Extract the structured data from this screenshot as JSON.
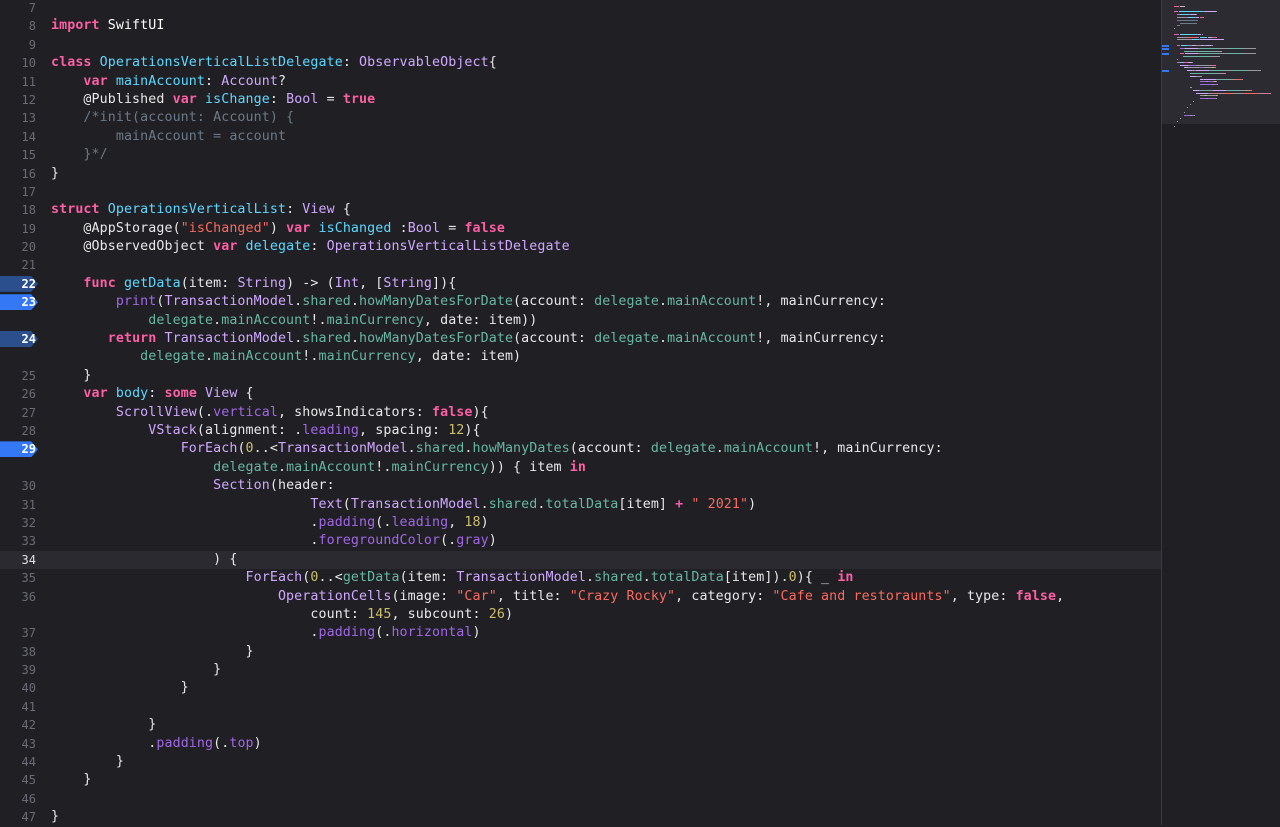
{
  "colors": {
    "background": "#1f1f24",
    "keyword": "#fc5fa3",
    "type": "#d0a8ff",
    "declaration": "#5dd8ff",
    "method": "#67b7a4",
    "property": "#a167e6",
    "string": "#fc6a5d",
    "number": "#d0bf69",
    "comment": "#6c7986",
    "breakpoint": "#3478f6"
  },
  "editor": {
    "current_line": 34,
    "lines": [
      {
        "num": "7",
        "tokens": []
      },
      {
        "num": "8",
        "tokens": [
          [
            "import",
            "kw"
          ],
          [
            " SwiftUI",
            "code"
          ]
        ]
      },
      {
        "num": "9",
        "tokens": []
      },
      {
        "num": "10",
        "tokens": [
          [
            "class",
            "kw"
          ],
          [
            " ",
            "plain"
          ],
          [
            "OperationsVerticalListDelegate",
            "decl"
          ],
          [
            ": ",
            "plain"
          ],
          [
            "ObservableObject",
            "type"
          ],
          [
            "{",
            "plain"
          ]
        ]
      },
      {
        "num": "11",
        "tokens": [
          [
            "    ",
            "plain"
          ],
          [
            "var",
            "kw"
          ],
          [
            " ",
            "plain"
          ],
          [
            "mainAccount",
            "decl"
          ],
          [
            ": ",
            "plain"
          ],
          [
            "Account",
            "type"
          ],
          [
            "?",
            "plain"
          ]
        ]
      },
      {
        "num": "12",
        "tokens": [
          [
            "    @Published ",
            "plain"
          ],
          [
            "var",
            "kw"
          ],
          [
            " ",
            "plain"
          ],
          [
            "isChange",
            "decl"
          ],
          [
            ": ",
            "plain"
          ],
          [
            "Bool",
            "type"
          ],
          [
            " = ",
            "plain"
          ],
          [
            "true",
            "kw"
          ]
        ]
      },
      {
        "num": "13",
        "tokens": [
          [
            "    /*init(account: Account) {",
            "cmt"
          ]
        ]
      },
      {
        "num": "14",
        "tokens": [
          [
            "        mainAccount = account",
            "cmt"
          ]
        ]
      },
      {
        "num": "15",
        "tokens": [
          [
            "    }*/",
            "cmt"
          ]
        ]
      },
      {
        "num": "16",
        "tokens": [
          [
            "}",
            "plain"
          ]
        ]
      },
      {
        "num": "17",
        "tokens": []
      },
      {
        "num": "18",
        "tokens": [
          [
            "struct",
            "kw"
          ],
          [
            " ",
            "plain"
          ],
          [
            "OperationsVerticalList",
            "decl"
          ],
          [
            ": ",
            "plain"
          ],
          [
            "View",
            "type"
          ],
          [
            " {",
            "plain"
          ]
        ]
      },
      {
        "num": "19",
        "tokens": [
          [
            "    @AppStorage(",
            "plain"
          ],
          [
            "\"isChanged\"",
            "str"
          ],
          [
            ") ",
            "plain"
          ],
          [
            "var",
            "kw"
          ],
          [
            " ",
            "plain"
          ],
          [
            "isChanged",
            "decl"
          ],
          [
            " :",
            "plain"
          ],
          [
            "Bool",
            "type"
          ],
          [
            " = ",
            "plain"
          ],
          [
            "false",
            "kw"
          ]
        ]
      },
      {
        "num": "20",
        "tokens": [
          [
            "    @ObservedObject ",
            "plain"
          ],
          [
            "var",
            "kw"
          ],
          [
            " ",
            "plain"
          ],
          [
            "delegate",
            "decl"
          ],
          [
            ": ",
            "plain"
          ],
          [
            "OperationsVerticalListDelegate",
            "type"
          ]
        ]
      },
      {
        "num": "21",
        "tokens": []
      },
      {
        "num": "22",
        "bp": "disabled",
        "tokens": [
          [
            "    ",
            "plain"
          ],
          [
            "func",
            "kw"
          ],
          [
            " ",
            "plain"
          ],
          [
            "getData",
            "decl"
          ],
          [
            "(item: ",
            "plain"
          ],
          [
            "String",
            "type"
          ],
          [
            ") -> (",
            "plain"
          ],
          [
            "Int",
            "type"
          ],
          [
            ", [",
            "plain"
          ],
          [
            "String",
            "type"
          ],
          [
            "]){",
            "plain"
          ]
        ]
      },
      {
        "num": "23",
        "bp": "enabled",
        "tokens": [
          [
            "        ",
            "plain"
          ],
          [
            "print",
            "ref"
          ],
          [
            "(",
            "plain"
          ],
          [
            "TransactionModel",
            "type"
          ],
          [
            ".",
            "plain"
          ],
          [
            "shared",
            "method"
          ],
          [
            ".",
            "plain"
          ],
          [
            "howManyDatesForDate",
            "method"
          ],
          [
            "(account: ",
            "plain"
          ],
          [
            "delegate",
            "method"
          ],
          [
            ".",
            "plain"
          ],
          [
            "mainAccount",
            "method"
          ],
          [
            "!, mainCurrency:",
            "plain"
          ]
        ]
      },
      {
        "num": "",
        "tokens": [
          [
            "            ",
            "plain"
          ],
          [
            "delegate",
            "method"
          ],
          [
            ".",
            "plain"
          ],
          [
            "mainAccount",
            "method"
          ],
          [
            "!.",
            "plain"
          ],
          [
            "mainCurrency",
            "method"
          ],
          [
            ", date: item))",
            "plain"
          ]
        ]
      },
      {
        "num": "24",
        "bp": "disabled",
        "tokens": [
          [
            "       ",
            "plain"
          ],
          [
            "return",
            "kw"
          ],
          [
            " ",
            "plain"
          ],
          [
            "TransactionModel",
            "type"
          ],
          [
            ".",
            "plain"
          ],
          [
            "shared",
            "method"
          ],
          [
            ".",
            "plain"
          ],
          [
            "howManyDatesForDate",
            "method"
          ],
          [
            "(account: ",
            "plain"
          ],
          [
            "delegate",
            "method"
          ],
          [
            ".",
            "plain"
          ],
          [
            "mainAccount",
            "method"
          ],
          [
            "!, mainCurrency:",
            "plain"
          ]
        ]
      },
      {
        "num": "",
        "tokens": [
          [
            "           ",
            "plain"
          ],
          [
            "delegate",
            "method"
          ],
          [
            ".",
            "plain"
          ],
          [
            "mainAccount",
            "method"
          ],
          [
            "!.",
            "plain"
          ],
          [
            "mainCurrency",
            "method"
          ],
          [
            ", date: item)",
            "plain"
          ]
        ]
      },
      {
        "num": "25",
        "tokens": [
          [
            "    }",
            "plain"
          ]
        ]
      },
      {
        "num": "26",
        "tokens": [
          [
            "    ",
            "plain"
          ],
          [
            "var",
            "kw"
          ],
          [
            " ",
            "plain"
          ],
          [
            "body",
            "decl"
          ],
          [
            ": ",
            "plain"
          ],
          [
            "some",
            "kw"
          ],
          [
            " ",
            "plain"
          ],
          [
            "View",
            "type"
          ],
          [
            " {",
            "plain"
          ]
        ]
      },
      {
        "num": "27",
        "tokens": [
          [
            "        ",
            "plain"
          ],
          [
            "ScrollView",
            "type"
          ],
          [
            "(.",
            "plain"
          ],
          [
            "vertical",
            "ref"
          ],
          [
            ", showsIndicators: ",
            "plain"
          ],
          [
            "false",
            "kw"
          ],
          [
            "){",
            "plain"
          ]
        ]
      },
      {
        "num": "28",
        "tokens": [
          [
            "            ",
            "plain"
          ],
          [
            "VStack",
            "type"
          ],
          [
            "(alignment: .",
            "plain"
          ],
          [
            "leading",
            "ref"
          ],
          [
            ", spacing: ",
            "plain"
          ],
          [
            "12",
            "num"
          ],
          [
            "){",
            "plain"
          ]
        ]
      },
      {
        "num": "29",
        "bp": "enabled",
        "tokens": [
          [
            "                ",
            "plain"
          ],
          [
            "ForEach",
            "type"
          ],
          [
            "(",
            "plain"
          ],
          [
            "0",
            "num"
          ],
          [
            "..<",
            "plain"
          ],
          [
            "TransactionModel",
            "type"
          ],
          [
            ".",
            "plain"
          ],
          [
            "shared",
            "method"
          ],
          [
            ".",
            "plain"
          ],
          [
            "howManyDates",
            "method"
          ],
          [
            "(account: ",
            "plain"
          ],
          [
            "delegate",
            "method"
          ],
          [
            ".",
            "plain"
          ],
          [
            "mainAccount",
            "method"
          ],
          [
            "!, mainCurrency:",
            "plain"
          ]
        ]
      },
      {
        "num": "",
        "tokens": [
          [
            "                    ",
            "plain"
          ],
          [
            "delegate",
            "method"
          ],
          [
            ".",
            "plain"
          ],
          [
            "mainAccount",
            "method"
          ],
          [
            "!.",
            "plain"
          ],
          [
            "mainCurrency",
            "method"
          ],
          [
            ")) { item ",
            "plain"
          ],
          [
            "in",
            "kw"
          ]
        ]
      },
      {
        "num": "30",
        "tokens": [
          [
            "                    ",
            "plain"
          ],
          [
            "Section",
            "type"
          ],
          [
            "(header:",
            "plain"
          ]
        ]
      },
      {
        "num": "31",
        "tokens": [
          [
            "                                ",
            "plain"
          ],
          [
            "Text",
            "type"
          ],
          [
            "(",
            "plain"
          ],
          [
            "TransactionModel",
            "type"
          ],
          [
            ".",
            "plain"
          ],
          [
            "shared",
            "method"
          ],
          [
            ".",
            "plain"
          ],
          [
            "totalData",
            "method"
          ],
          [
            "[item] ",
            "plain"
          ],
          [
            "+",
            "kw"
          ],
          [
            " ",
            "plain"
          ],
          [
            "\" 2021\"",
            "str"
          ],
          [
            ")",
            "plain"
          ]
        ]
      },
      {
        "num": "32",
        "tokens": [
          [
            "                                .",
            "plain"
          ],
          [
            "padding",
            "ref"
          ],
          [
            "(.",
            "plain"
          ],
          [
            "leading",
            "ref"
          ],
          [
            ", ",
            "plain"
          ],
          [
            "18",
            "num"
          ],
          [
            ")",
            "plain"
          ]
        ]
      },
      {
        "num": "33",
        "tokens": [
          [
            "                                .",
            "plain"
          ],
          [
            "foregroundColor",
            "ref"
          ],
          [
            "(.",
            "plain"
          ],
          [
            "gray",
            "ref"
          ],
          [
            ")",
            "plain"
          ]
        ]
      },
      {
        "num": "34",
        "tokens": [
          [
            "                    ) {",
            "plain"
          ]
        ]
      },
      {
        "num": "35",
        "tokens": [
          [
            "                        ",
            "plain"
          ],
          [
            "ForEach",
            "type"
          ],
          [
            "(",
            "plain"
          ],
          [
            "0",
            "num"
          ],
          [
            "..<",
            "plain"
          ],
          [
            "getData",
            "method"
          ],
          [
            "(item: ",
            "plain"
          ],
          [
            "TransactionModel",
            "type"
          ],
          [
            ".",
            "plain"
          ],
          [
            "shared",
            "method"
          ],
          [
            ".",
            "plain"
          ],
          [
            "totalData",
            "method"
          ],
          [
            "[item]).",
            "plain"
          ],
          [
            "0",
            "num"
          ],
          [
            "){ _ ",
            "plain"
          ],
          [
            "in",
            "kw"
          ]
        ]
      },
      {
        "num": "36",
        "tokens": [
          [
            "                            ",
            "plain"
          ],
          [
            "OperationCells",
            "type"
          ],
          [
            "(image: ",
            "plain"
          ],
          [
            "\"Car\"",
            "str"
          ],
          [
            ", title: ",
            "plain"
          ],
          [
            "\"Crazy Rocky\"",
            "str"
          ],
          [
            ", category: ",
            "plain"
          ],
          [
            "\"Cafe and restoraunts\"",
            "str"
          ],
          [
            ", type: ",
            "plain"
          ],
          [
            "false",
            "kw"
          ],
          [
            ",",
            "plain"
          ]
        ]
      },
      {
        "num": "",
        "tokens": [
          [
            "                                count: ",
            "plain"
          ],
          [
            "145",
            "num"
          ],
          [
            ", subcount: ",
            "plain"
          ],
          [
            "26",
            "num"
          ],
          [
            ")",
            "plain"
          ]
        ]
      },
      {
        "num": "37",
        "tokens": [
          [
            "                                .",
            "plain"
          ],
          [
            "padding",
            "ref"
          ],
          [
            "(.",
            "plain"
          ],
          [
            "horizontal",
            "ref"
          ],
          [
            ")",
            "plain"
          ]
        ]
      },
      {
        "num": "38",
        "tokens": [
          [
            "                        }",
            "plain"
          ]
        ]
      },
      {
        "num": "39",
        "tokens": [
          [
            "                    }",
            "plain"
          ]
        ]
      },
      {
        "num": "40",
        "tokens": [
          [
            "                }",
            "plain"
          ]
        ]
      },
      {
        "num": "41",
        "tokens": []
      },
      {
        "num": "42",
        "tokens": [
          [
            "            }",
            "plain"
          ]
        ]
      },
      {
        "num": "43",
        "tokens": [
          [
            "            .",
            "plain"
          ],
          [
            "padding",
            "ref"
          ],
          [
            "(.",
            "plain"
          ],
          [
            "top",
            "ref"
          ],
          [
            ")",
            "plain"
          ]
        ]
      },
      {
        "num": "44",
        "tokens": [
          [
            "        }",
            "plain"
          ]
        ]
      },
      {
        "num": "45",
        "tokens": [
          [
            "    }",
            "plain"
          ]
        ]
      },
      {
        "num": "46",
        "tokens": []
      },
      {
        "num": "47",
        "tokens": [
          [
            "}",
            "plain"
          ]
        ]
      }
    ]
  }
}
